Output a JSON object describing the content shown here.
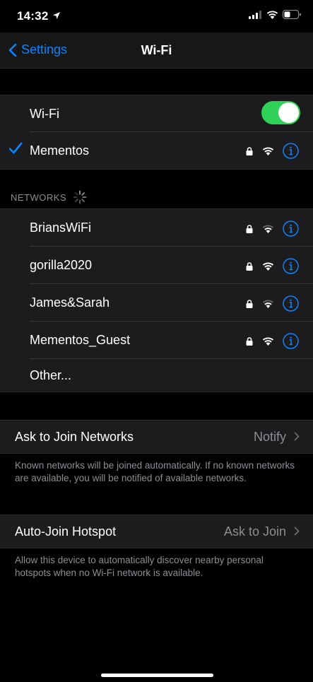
{
  "status": {
    "time": "14:32"
  },
  "nav": {
    "back_label": "Settings",
    "title": "Wi-Fi"
  },
  "wifi_toggle": {
    "label": "Wi-Fi",
    "on": true
  },
  "current_network": {
    "name": "Mementos",
    "connected": true
  },
  "networks_header": "NETWORKS",
  "networks": [
    {
      "name": "BriansWiFi"
    },
    {
      "name": "gorilla2020"
    },
    {
      "name": "James&Sarah"
    },
    {
      "name": "Mementos_Guest"
    }
  ],
  "other_label": "Other...",
  "ask_to_join": {
    "label": "Ask to Join Networks",
    "value": "Notify",
    "footer": "Known networks will be joined automatically. If no known networks are available, you will be notified of available networks."
  },
  "auto_join": {
    "label": "Auto-Join Hotspot",
    "value": "Ask to Join",
    "footer": "Allow this device to automatically discover nearby personal hotspots when no Wi-Fi network is available."
  },
  "colors": {
    "accent": "#0a84ff",
    "toggle_on": "#30d158",
    "background": "#000000",
    "cell": "#1c1c1e",
    "secondary_text": "#8d8d93"
  },
  "icons": [
    "location-arrow-icon",
    "cellular-signal-icon",
    "wifi-status-icon",
    "battery-icon",
    "chevron-left-icon",
    "checkmark-icon",
    "lock-icon",
    "wifi-signal-icon",
    "info-icon",
    "spinner-icon",
    "chevron-right-icon"
  ]
}
